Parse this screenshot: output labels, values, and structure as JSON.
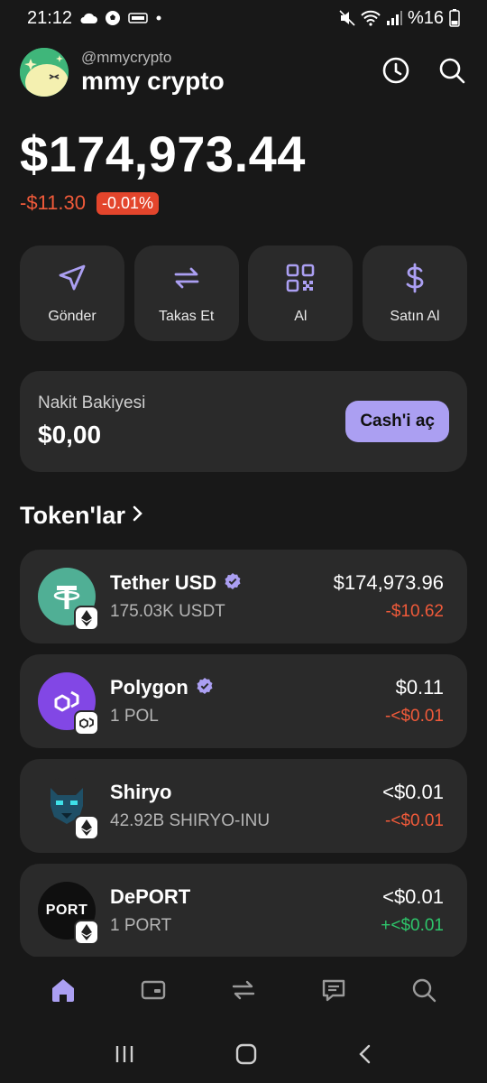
{
  "status_bar": {
    "time": "21:12",
    "battery": "%16"
  },
  "header": {
    "handle": "@mmycrypto",
    "wallet_name": "mmy crypto"
  },
  "balance": {
    "total": "$174,973.44",
    "change_amount": "-$11.30",
    "change_percent": "-0.01%"
  },
  "actions": [
    {
      "label": "Gönder",
      "icon": "send-icon"
    },
    {
      "label": "Takas Et",
      "icon": "swap-icon"
    },
    {
      "label": "Al",
      "icon": "qr-code-icon"
    },
    {
      "label": "Satın Al",
      "icon": "dollar-icon"
    }
  ],
  "cash": {
    "title": "Nakit Bakiyesi",
    "value": "$0,00",
    "button": "Cash'i aç"
  },
  "tokens_section": {
    "title": "Token'lar"
  },
  "tokens": [
    {
      "name": "Tether USD",
      "amount": "175.03K USDT",
      "usd": "$174,973.96",
      "change": "-$10.62",
      "change_dir": "neg",
      "verified": true,
      "chain": "ethereum"
    },
    {
      "name": "Polygon",
      "amount": "1 POL",
      "usd": "$0.11",
      "change": "-<$0.01",
      "change_dir": "neg",
      "verified": true,
      "chain": "polygon"
    },
    {
      "name": "Shiryo",
      "amount": "42.92B SHIRYO-INU",
      "usd": "<$0.01",
      "change": "-<$0.01",
      "change_dir": "neg",
      "verified": false,
      "chain": "ethereum"
    },
    {
      "name": "DePORT",
      "amount": "1 PORT",
      "usd": "<$0.01",
      "change": "+<$0.01",
      "change_dir": "pos",
      "verified": false,
      "chain": "ethereum",
      "logo_text": "PORT"
    }
  ],
  "colors": {
    "accent": "#ab9ff2",
    "negative": "#f05a3a",
    "positive": "#2ec66b",
    "card": "#2a2a2a",
    "background": "#181818"
  }
}
